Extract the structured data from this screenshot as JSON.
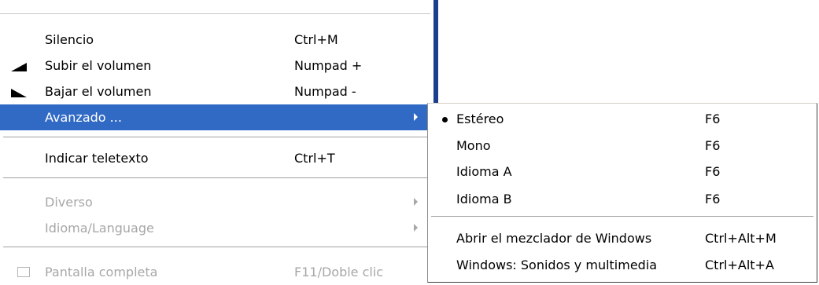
{
  "menu": {
    "items": [
      {
        "label": "Silencio",
        "shortcut": "Ctrl+M",
        "icon": ""
      },
      {
        "label": "Subir el volumen",
        "shortcut": "Numpad +",
        "icon": "volume-up-icon"
      },
      {
        "label": "Bajar el  volumen",
        "shortcut": "Numpad -",
        "icon": "volume-down-icon"
      },
      {
        "label": "Avanzado ...",
        "shortcut": "",
        "submenu": true,
        "highlighted": true
      },
      {
        "label": "Indicar teletexto",
        "shortcut": "Ctrl+T"
      },
      {
        "label": "Diverso",
        "shortcut": "",
        "submenu": true,
        "disabled": true
      },
      {
        "label": "Idioma/Language",
        "shortcut": "",
        "submenu": true,
        "disabled": true
      },
      {
        "label": "Pantalla completa",
        "shortcut": "F11/Doble clic",
        "disabled": true,
        "icon": "checkbox-icon"
      }
    ]
  },
  "submenu": {
    "items": [
      {
        "label": "Estéreo",
        "shortcut": "F6",
        "checked": true
      },
      {
        "label": "Mono",
        "shortcut": "F6"
      },
      {
        "label": "Idioma A",
        "shortcut": "F6"
      },
      {
        "label": "Idioma B",
        "shortcut": "F6"
      },
      {
        "label": "Abrir el mezclador de Windows",
        "shortcut": "Ctrl+Alt+M"
      },
      {
        "label": "Windows: Sonidos y multimedia",
        "shortcut": "Ctrl+Alt+A"
      }
    ]
  },
  "colors": {
    "highlight": "#316ac5",
    "disabled": "#a7a7a7",
    "edge": "#1b3f8c"
  }
}
